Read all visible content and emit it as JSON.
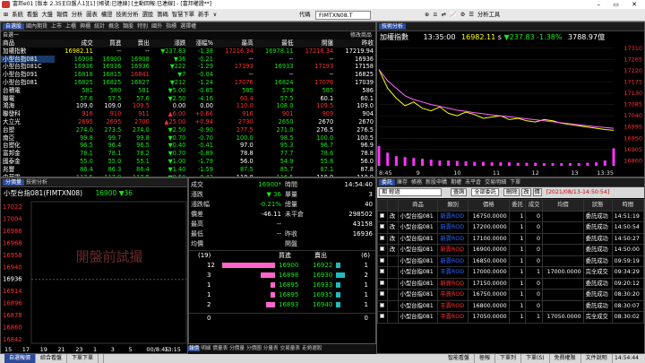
{
  "titlebar": {
    "text": "富邦e01 [版本 2.35][日盤人1][1] [帳號:已連線] [主動回報:已連線] - [富邦權證**]",
    "controls": "– ▭ ✕"
  },
  "menubar": {
    "items": [
      "⊞",
      "系統",
      "看盤",
      "大盤",
      "報價",
      "分析",
      "圖表",
      "權證",
      "技術分析",
      "選股",
      "籌碼",
      "智慧下單",
      "新手",
      "∨"
    ],
    "code": "FIMTXN08.T",
    "code_label": "代碼",
    "right_items": [
      "⊕",
      "≡",
      "⇄",
      "📈",
      "⚙",
      "☰",
      "分析工具"
    ]
  },
  "quote": {
    "tabs": [
      "自選股",
      "國內期貨",
      "上市",
      "上櫃",
      "興櫃",
      "統計",
      "概念",
      "類股",
      "特別",
      "國外",
      "指標",
      "選擇權"
    ],
    "subtitle": "自選一",
    "edit_label": "修改商品",
    "columns": [
      "商品",
      "成交",
      "買進",
      "賣出",
      "漲跌",
      "漲幅%",
      "最高",
      "最低",
      "開盤",
      "昨收"
    ],
    "rows": [
      {
        "c": [
          "加權指數",
          "16982.11",
          "--",
          "--",
          "▼237.83",
          "-1.38",
          "17216.34",
          "16978.11",
          "17216.34",
          "17219.94"
        ],
        "col": [
          "w",
          "y",
          "w",
          "w",
          "g",
          "g",
          "r",
          "g",
          "r",
          "w"
        ]
      },
      {
        "c": [
          "小型台指081",
          "16908",
          "16900",
          "16908",
          "▼36",
          "-0.21",
          "--",
          "--",
          "--",
          "16936"
        ],
        "col": [
          "w",
          "g",
          "g",
          "g",
          "g",
          "g",
          "w",
          "w",
          "w",
          "w"
        ]
      },
      {
        "c": [
          "小型台指081C",
          "16936",
          "16936",
          "16936",
          "▼222",
          "-1.29",
          "17193",
          "16933",
          "17193",
          "17158"
        ],
        "col": [
          "w",
          "g",
          "g",
          "g",
          "g",
          "g",
          "r",
          "g",
          "r",
          "w"
        ]
      },
      {
        "c": [
          "小型台指091",
          "16818",
          "16815",
          "16841",
          "▼7",
          "-0.04",
          "--",
          "--",
          "--",
          "16825"
        ],
        "col": [
          "w",
          "g",
          "g",
          "r",
          "g",
          "g",
          "w",
          "w",
          "w",
          "w"
        ]
      },
      {
        "c": [
          "小型台指081",
          "16825",
          "16825",
          "16827",
          "▼212",
          "-1.24",
          "17076",
          "16824",
          "17076",
          "17039"
        ],
        "col": [
          "w",
          "g",
          "g",
          "g",
          "g",
          "g",
          "r",
          "g",
          "r",
          "w"
        ]
      },
      {
        "c": [
          "台積電",
          "581",
          "580",
          "581",
          "▼5.00",
          "-0.85",
          "585",
          "579",
          "585",
          "586"
        ],
        "col": [
          "w",
          "g",
          "g",
          "g",
          "g",
          "g",
          "g",
          "g",
          "g",
          "w"
        ]
      },
      {
        "c": [
          "聯電",
          "57.6",
          "57.5",
          "57.6",
          "▼2.50",
          "-4.16",
          "60.4",
          "57.5",
          "60.1",
          "60.1"
        ],
        "col": [
          "w",
          "g",
          "g",
          "g",
          "g",
          "g",
          "r",
          "g",
          "w",
          "w"
        ]
      },
      {
        "c": [
          "鴻海",
          "109.0",
          "109.0",
          "109.5",
          "0.00",
          "0.00",
          "110.0",
          "108.0",
          "109.5",
          "109.0"
        ],
        "col": [
          "w",
          "w",
          "w",
          "r",
          "w",
          "w",
          "r",
          "g",
          "r",
          "w"
        ]
      },
      {
        "c": [
          "聯發科",
          "916",
          "910",
          "911",
          "▲6.00",
          "+0.66",
          "916",
          "901",
          "909",
          "904"
        ],
        "col": [
          "w",
          "r",
          "r",
          "r",
          "r",
          "r",
          "r",
          "r",
          "r",
          "w"
        ]
      },
      {
        "c": [
          "大立光",
          "2695",
          "2695",
          "2700",
          "▲25.00",
          "+0.94",
          "2730",
          "2650",
          "2670",
          "2670"
        ],
        "col": [
          "w",
          "r",
          "r",
          "r",
          "r",
          "r",
          "r",
          "g",
          "w",
          "w"
        ]
      },
      {
        "c": [
          "台塑",
          "274.0",
          "273.5",
          "274.0",
          "▼2.50",
          "-0.90",
          "277.5",
          "271.0",
          "276.5",
          "276.5"
        ],
        "col": [
          "w",
          "g",
          "g",
          "g",
          "g",
          "g",
          "r",
          "g",
          "w",
          "w"
        ]
      },
      {
        "c": [
          "南亞",
          "99.8",
          "99.7",
          "99.8",
          "▼0.70",
          "-0.70",
          "100.0",
          "98.5",
          "100.0",
          "100.5"
        ],
        "col": [
          "w",
          "g",
          "g",
          "g",
          "g",
          "g",
          "g",
          "g",
          "g",
          "w"
        ]
      },
      {
        "c": [
          "台塑化",
          "96.5",
          "96.4",
          "96.5",
          "▼0.40",
          "-0.41",
          "97.0",
          "95.3",
          "96.7",
          "96.9"
        ],
        "col": [
          "w",
          "g",
          "g",
          "g",
          "g",
          "g",
          "w",
          "g",
          "g",
          "w"
        ]
      },
      {
        "c": [
          "富邦金",
          "78.1",
          "78.1",
          "78.2",
          "▼0.70",
          "-0.89",
          "78.8",
          "77.7",
          "78.6",
          "78.8"
        ],
        "col": [
          "w",
          "g",
          "g",
          "g",
          "g",
          "g",
          "w",
          "g",
          "g",
          "w"
        ]
      },
      {
        "c": [
          "國泰金",
          "55.0",
          "55.0",
          "55.1",
          "▼1.00",
          "-1.79",
          "56.0",
          "54.9",
          "55.8",
          "56.0"
        ],
        "col": [
          "w",
          "g",
          "g",
          "g",
          "g",
          "g",
          "w",
          "g",
          "g",
          "w"
        ]
      },
      {
        "c": [
          "兆豐",
          "86.4",
          "86.3",
          "86.4",
          "▼1.40",
          "-1.59",
          "87.5",
          "85.7",
          "87.1",
          "87.8"
        ],
        "col": [
          "w",
          "g",
          "g",
          "g",
          "g",
          "g",
          "g",
          "g",
          "g",
          "w"
        ]
      },
      {
        "c": [
          "中華電",
          "117.5",
          "117.0",
          "117.5",
          "▼0.50",
          "-0.42",
          "118.0",
          "116.5",
          "118.0",
          "118.0"
        ],
        "col": [
          "w",
          "g",
          "g",
          "g",
          "g",
          "g",
          "w",
          "g",
          "w",
          "w"
        ]
      }
    ]
  },
  "index": {
    "tabs": [
      "技術分析"
    ],
    "name": "加權指數",
    "time": "13:35:00",
    "price": "16982.11",
    "price_unit": "s",
    "change": "▼237.83",
    "pct": "-1.38%",
    "volume": "3788.97億",
    "colors": {
      "price": "#ffff00",
      "avg": "#ff66ff",
      "volume": "#ff33ff"
    }
  },
  "index_chart": {
    "type": "line",
    "x_ticks": [
      "8:45",
      "9",
      "10",
      "11",
      "12",
      "13",
      "13:35"
    ],
    "y_ticks": [
      "17310",
      "17265",
      "17220",
      "17175",
      "17130",
      "17085",
      "17040",
      "16995",
      "16950",
      "16905",
      "16860"
    ],
    "ylim": [
      16840,
      17320
    ],
    "series": [
      {
        "values": [
          17225,
          17150,
          17110,
          17080,
          17095,
          17070,
          17060,
          17075,
          17050,
          17040,
          17055,
          17045,
          17030,
          17035,
          17040,
          17025,
          17030,
          17020,
          17015,
          17025,
          17020,
          17010,
          17005,
          17000,
          16995,
          16990,
          16985,
          16982
        ]
      },
      {
        "values": [
          17225,
          17180,
          17150,
          17120,
          17105,
          17095,
          17085,
          17078,
          17070,
          17062,
          17058,
          17052,
          17048,
          17043,
          17040,
          17036,
          17032,
          17028,
          17024,
          17020,
          17016,
          17012,
          17008,
          17004,
          17000,
          16996,
          16993,
          16990
        ]
      }
    ],
    "volume": [
      45,
      30,
      22,
      20,
      18,
      16,
      14,
      12,
      12,
      11,
      10,
      9,
      9,
      8,
      8,
      8,
      7,
      7,
      7,
      6,
      6,
      6,
      6,
      6,
      7,
      8,
      12,
      40
    ]
  },
  "tick": {
    "tabs": [
      "分價量",
      "技術分析"
    ],
    "name": "小型台指081(FIMTXN08)",
    "price": "16900",
    "change": "▼36",
    "y_ticks": [
      "17022",
      "17004",
      "16986",
      "16968",
      "16958",
      "16940",
      "16936",
      "16914",
      "16896",
      "16878",
      "16860",
      "16842"
    ],
    "x_ticks": [
      "15",
      "17",
      "19",
      "21",
      "23",
      "1",
      "3",
      "5",
      "00/8:45",
      "13:15"
    ],
    "overlay_text": "開盤前試撮",
    "bottom_tabs": [
      "報價",
      "明細",
      "價量表",
      "分價量",
      "分價圖",
      "分量表",
      "交易量表",
      "走勢選股"
    ]
  },
  "detail": {
    "left": [
      {
        "k": "成交",
        "v": "16900",
        "u": "*"
      },
      {
        "k": "漲跌",
        "v": "▼ 36",
        "u": ""
      },
      {
        "k": "漲跌幅",
        "v": "-0.21%",
        "u": ""
      },
      {
        "k": "價差",
        "v": "-46.11",
        "u": ""
      },
      {
        "k": "最高",
        "v": "--",
        "u": ""
      },
      {
        "k": "最低",
        "v": "--",
        "u": ""
      },
      {
        "k": "均價",
        "v": "",
        "u": ""
      }
    ],
    "right": [
      {
        "k": "時間",
        "v": "14:54:40"
      },
      {
        "k": "單量",
        "v": "3"
      },
      {
        "k": "總量",
        "v": "40"
      },
      {
        "k": "未平倉",
        "v": "298502"
      },
      {
        "k": "",
        "v": "43158"
      },
      {
        "k": "昨收",
        "v": "16936"
      },
      {
        "k": "開盤",
        "v": ""
      }
    ],
    "book_head": {
      "left": "(19)",
      "bid": "買進",
      "ask": "賣出",
      "right": "(6)"
    },
    "book": [
      {
        "bq": "12",
        "bp": "16900",
        "ap": "16922",
        "aq": "1",
        "bw": 0.95,
        "aw": 0.17
      },
      {
        "bq": "3",
        "bp": "16898",
        "ap": "16930",
        "aq": "2",
        "bw": 0.25,
        "aw": 0.33
      },
      {
        "bq": "1",
        "bp": "16895",
        "ap": "16933",
        "aq": "1",
        "bw": 0.08,
        "aw": 0.17
      },
      {
        "bq": "1",
        "bp": "16895",
        "ap": "16935",
        "aq": "1",
        "bw": 0.08,
        "aw": 0.17
      },
      {
        "bq": "2",
        "bp": "16893",
        "ap": "16940",
        "aq": "1",
        "bw": 0.16,
        "aw": 0.17
      }
    ],
    "total": {
      "bq": "0",
      "aq": "0"
    }
  },
  "orders": {
    "tabs": [
      "委託",
      "庫存",
      "帳務",
      "新股申購",
      "期權",
      "未平倉",
      "交易明細",
      "下單"
    ],
    "toolbar": {
      "account": "期 輕過",
      "query": "查詢",
      "filter": "全部委託",
      "delete": "刪除",
      "change": "改",
      "cancel": "價",
      "stamp": "[2021/08/13-14:50:54]"
    },
    "columns": [
      "",
      "",
      "商品",
      "類別",
      "價格",
      "委託",
      "成交",
      "均價",
      "狀態",
      "時間"
    ],
    "rows": [
      {
        "act": "改",
        "name": "小型台指081",
        "type": "新賣ROD",
        "tcol": "#3366ff",
        "price": "16750.0000",
        "qty": "1",
        "fill": "0",
        "avg": "",
        "status": "委託成功",
        "time": "14:51:19"
      },
      {
        "act": "改",
        "name": "小型台指081",
        "type": "新賣ROD",
        "tcol": "#3366ff",
        "price": "17200.0000",
        "qty": "1",
        "fill": "0",
        "avg": "",
        "status": "委託成功",
        "time": "14:50:54"
      },
      {
        "act": "改",
        "name": "小型台指081",
        "type": "新賣ROD",
        "tcol": "#3366ff",
        "price": "17100.0000",
        "qty": "1",
        "fill": "0",
        "avg": "",
        "status": "委託成功",
        "time": "14:50:27"
      },
      {
        "act": "改",
        "name": "小型台指081",
        "type": "新賣ROD",
        "tcol": "#ff3333",
        "price": "16900.0000",
        "qty": "1",
        "fill": "0",
        "avg": "",
        "status": "委託成功",
        "time": "14:50:00"
      },
      {
        "act": "",
        "name": "小型台指081",
        "type": "新賣ROD",
        "tcol": "#3366ff",
        "price": "16850.0000",
        "qty": "1",
        "fill": "0",
        "avg": "",
        "status": "委託成功",
        "time": "09:59:19"
      },
      {
        "act": "",
        "name": "小型台指081",
        "type": "平賣ROD",
        "tcol": "#3366ff",
        "price": "17000.0000",
        "qty": "1",
        "fill": "1",
        "avg": "17000.0000",
        "status": "完全成交",
        "time": "09:34:29"
      },
      {
        "act": "",
        "name": "小型台指081",
        "type": "新買ROD",
        "tcol": "#ff3333",
        "price": "17150.0000",
        "qty": "1",
        "fill": "0",
        "avg": "",
        "status": "委託成功",
        "time": "09:20:12"
      },
      {
        "act": "",
        "name": "小型台指081",
        "type": "平買ROD",
        "tcol": "#ff3333",
        "price": "16750.0000",
        "qty": "1",
        "fill": "0",
        "avg": "",
        "status": "委託成功",
        "time": "08:30:20"
      },
      {
        "act": "",
        "name": "小型台指081",
        "type": "平賣ROD",
        "tcol": "#ff3333",
        "price": "16800.0000",
        "qty": "1",
        "fill": "0",
        "avg": "",
        "status": "委託成功",
        "time": "08:30:07"
      },
      {
        "act": "",
        "name": "小型台指081",
        "type": "平賣ROD",
        "tcol": "#ff3333",
        "price": "17050.0000",
        "qty": "1",
        "fill": "1",
        "avg": "17050.0000",
        "status": "完全成交",
        "time": "08:30:02"
      }
    ]
  },
  "statusbar": {
    "left": [
      "自選報價",
      "綜合看盤",
      "下單下單"
    ],
    "right": [
      "智能看盤",
      "極報",
      "下單列",
      "下單(S)",
      "免費權限",
      "文件說明"
    ],
    "time": "14:54:44"
  }
}
